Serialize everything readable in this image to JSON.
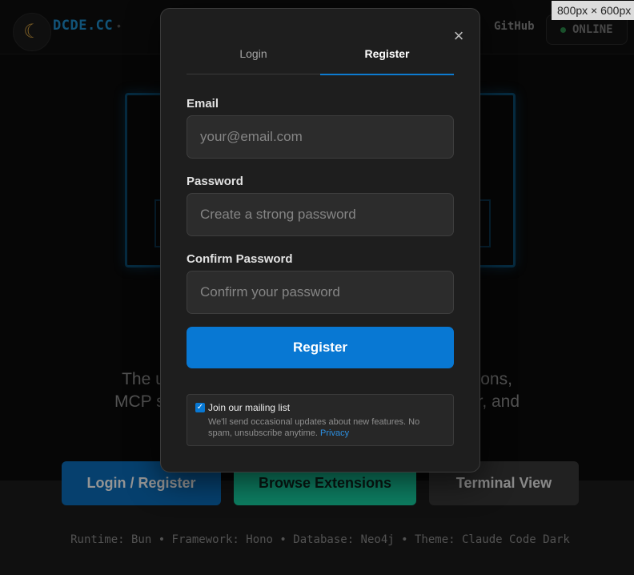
{
  "nav": {
    "logo_glyph": "☾",
    "brand": "DCDE.CC",
    "brand_separator": "•",
    "github_label": "GitHub",
    "status_label": "ONLINE"
  },
  "viewport_badge": "800px × 600px",
  "hero": {
    "tagline_line1": "The uno                                                         ensions,",
    "tagline_line2": "MCP ser                                                          over, and"
  },
  "cta": {
    "login_register": "Login / Register",
    "browse_extensions": "Browse Extensions",
    "terminal_view": "Terminal View"
  },
  "footer": {
    "tech_line": "Runtime: Bun • Framework: Hono • Database: Neo4j • Theme: Claude Code Dark"
  },
  "modal": {
    "close_glyph": "×",
    "tabs": [
      {
        "label": "Login",
        "active": false
      },
      {
        "label": "Register",
        "active": true
      }
    ],
    "email": {
      "label": "Email",
      "value": "",
      "placeholder": "your@email.com"
    },
    "password": {
      "label": "Password",
      "value": "",
      "placeholder": "Create a strong password"
    },
    "confirm_password": {
      "label": "Confirm Password",
      "value": "",
      "placeholder": "Confirm your password"
    },
    "submit_label": "Register",
    "mailing": {
      "checked": true,
      "check_glyph": "✓",
      "title": "Join our mailing list",
      "description": "We'll send occasional updates about new features. No spam, unsubscribe anytime.",
      "privacy_link": "Privacy"
    }
  },
  "colors": {
    "accent": "#0878d3",
    "brand": "#1e8fcf",
    "browse_button": "#18d7a8",
    "modal_bg": "#1e1e1e"
  }
}
